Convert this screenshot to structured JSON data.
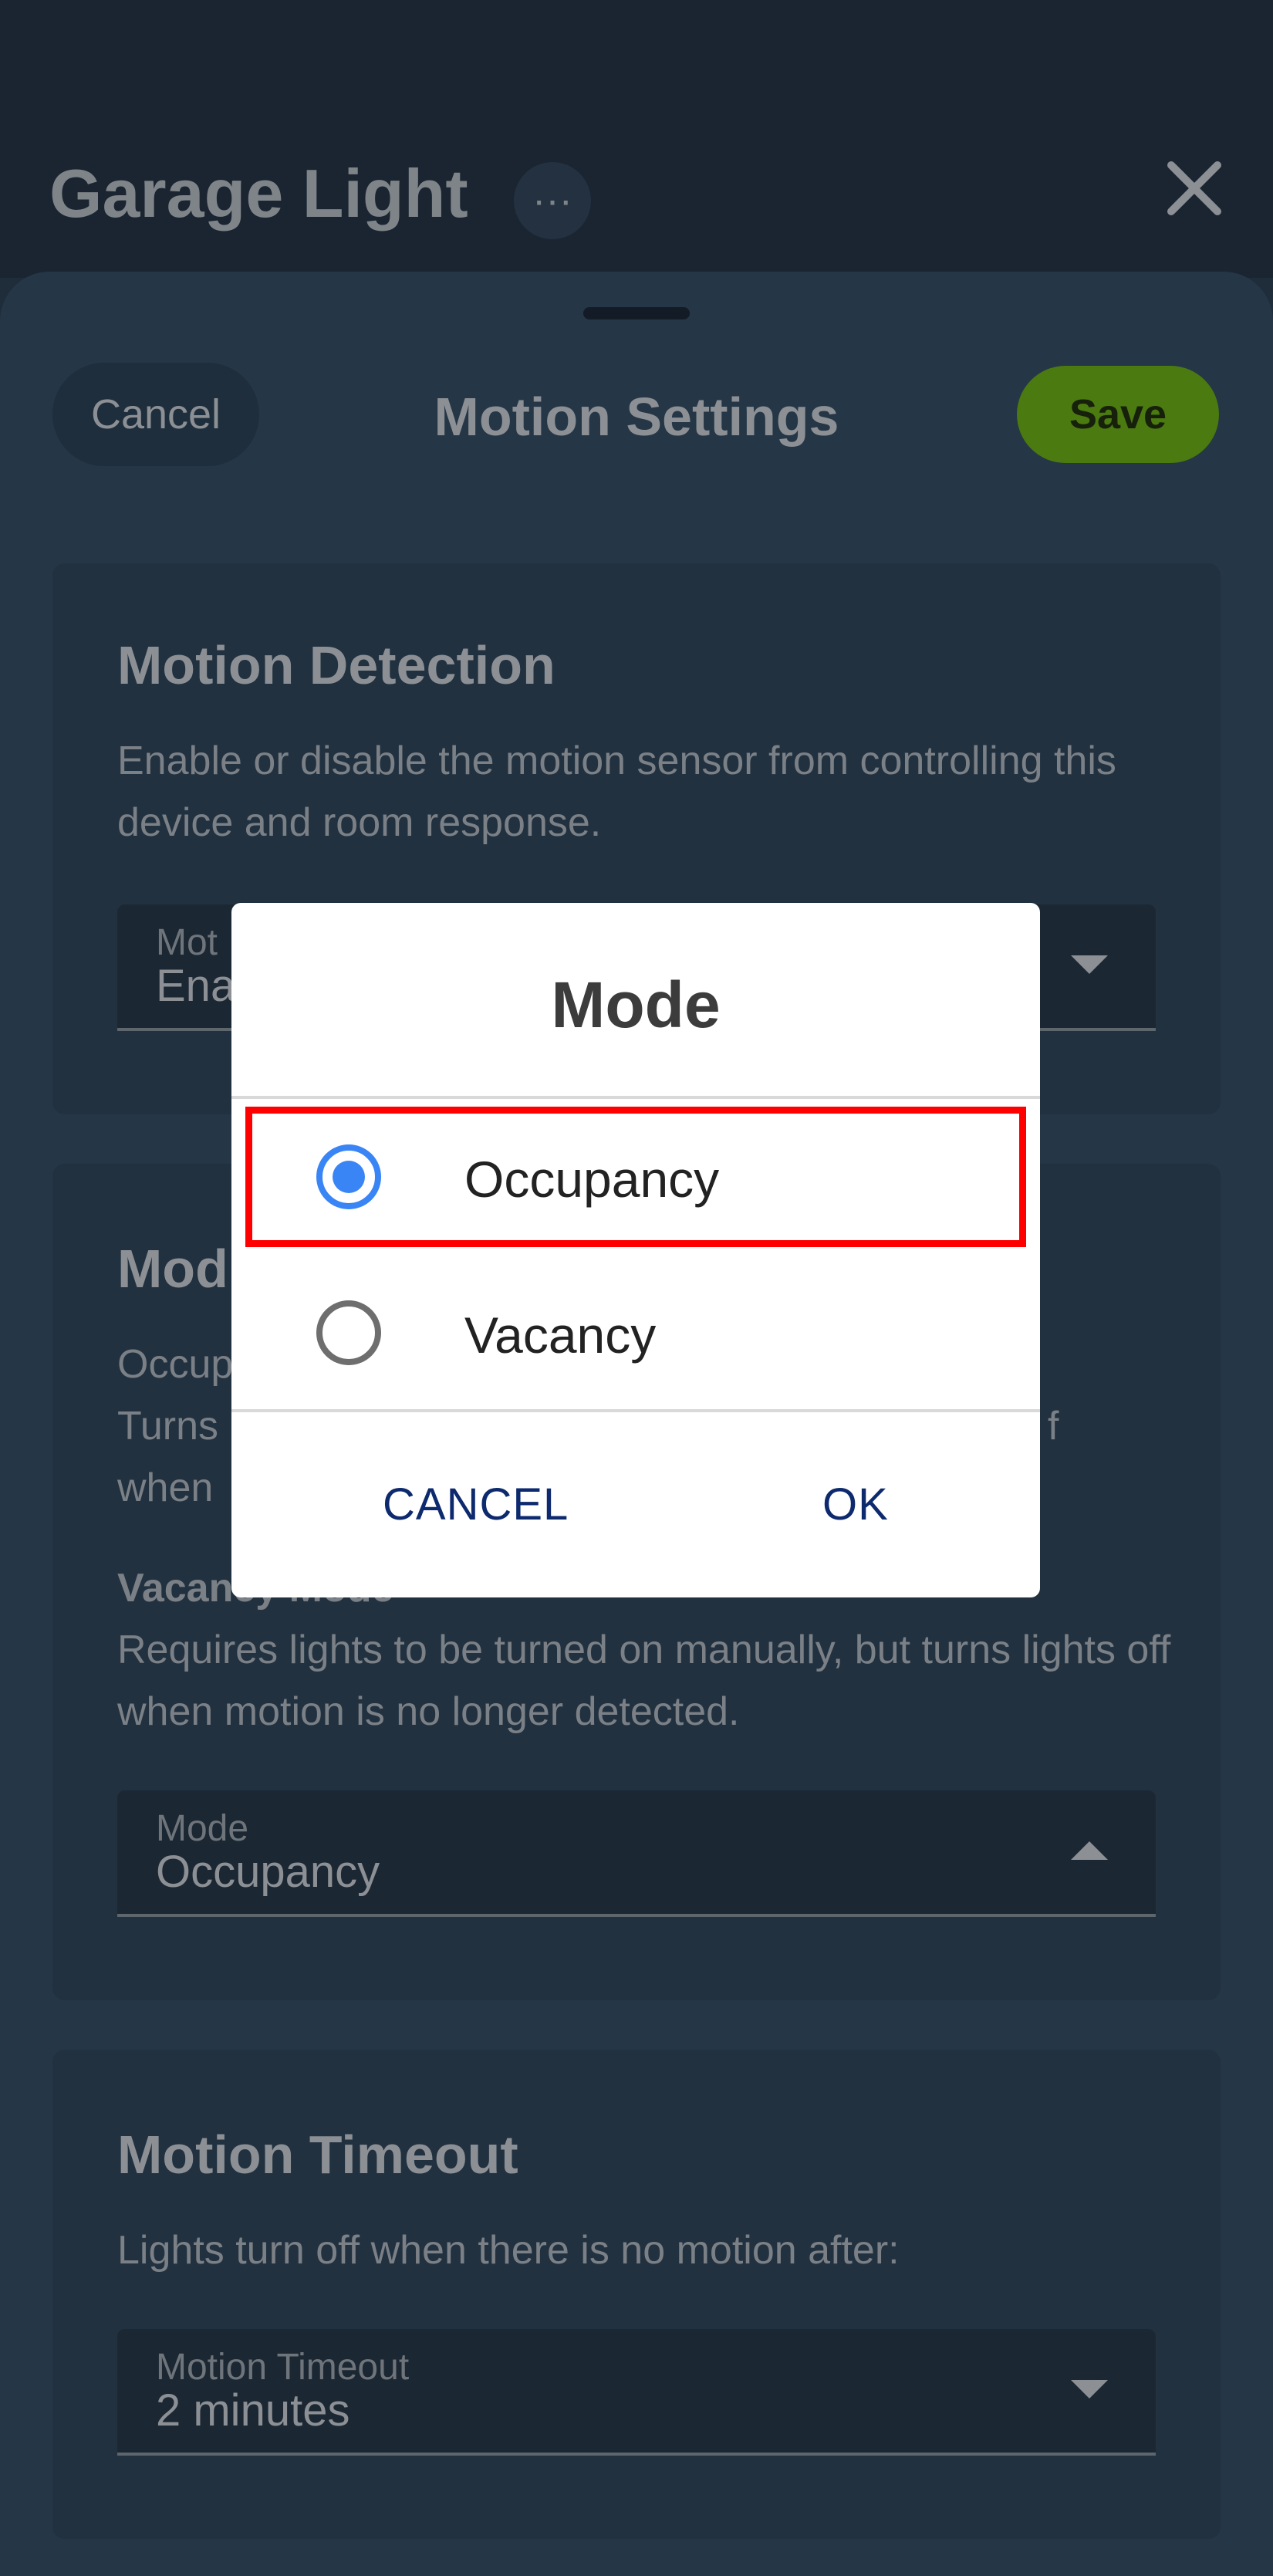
{
  "header": {
    "title": "Garage Light",
    "more_label": "···",
    "close_icon": "close-icon"
  },
  "sheet": {
    "title": "Motion Settings",
    "cancel_label": "Cancel",
    "save_label": "Save",
    "save_color": "#4a7a10"
  },
  "motion_detection": {
    "title": "Motion Detection",
    "description": "Enable or disable the motion sensor from controlling this device and room response.",
    "field_label": "Mot",
    "field_value": "Ena"
  },
  "mode_section": {
    "title": "Mod",
    "occupancy_head": "Occup",
    "occupancy_line1": "Turns",
    "occupancy_line1_end": "f",
    "occupancy_line2": "when",
    "vacancy_head": "Vacancy Mode",
    "vacancy_desc": "Requires lights to be turned on manually, but turns lights off when motion is no longer detected.",
    "field_label": "Mode",
    "field_value": "Occupancy"
  },
  "motion_timeout": {
    "title": "Motion Timeout",
    "description": "Lights turn off when there is no motion after:",
    "field_label": "Motion Timeout",
    "field_value": "2 minutes"
  },
  "dialog": {
    "title": "Mode",
    "options": [
      {
        "label": "Occupancy",
        "selected": true
      },
      {
        "label": "Vacancy",
        "selected": false
      }
    ],
    "cancel_label": "CANCEL",
    "ok_label": "OK",
    "radio_color": "#3a85f5",
    "highlight_color": "#ff0000"
  }
}
